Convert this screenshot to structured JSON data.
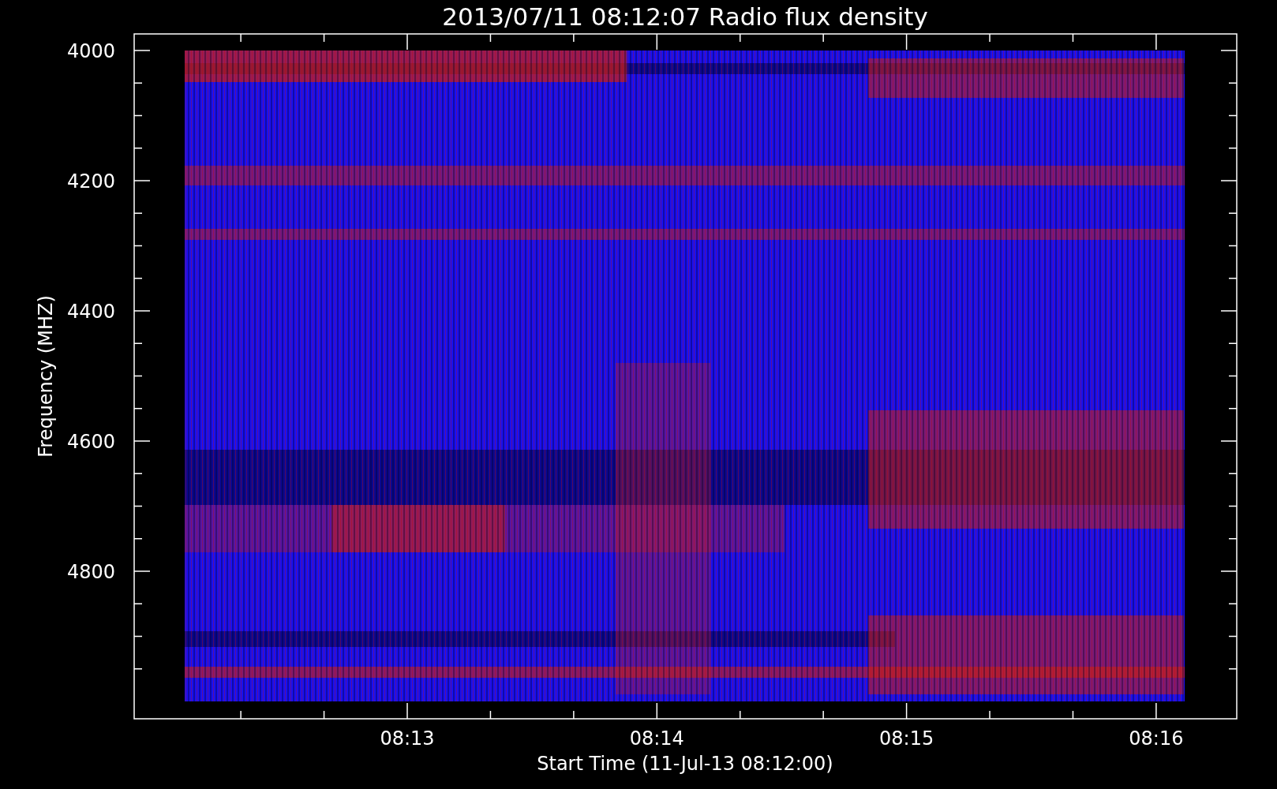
{
  "title": "2013/07/11 08:12:07 Radio flux density",
  "y_axis": {
    "label": "Frequency (MHZ)",
    "tick_labels": [
      "4000",
      "4200",
      "4400",
      "4600",
      "4800"
    ]
  },
  "x_axis": {
    "label": "Start Time (11-Jul-13 08:12:00)",
    "tick_labels": [
      "08:13",
      "08:14",
      "08:15",
      "08:16"
    ]
  }
}
